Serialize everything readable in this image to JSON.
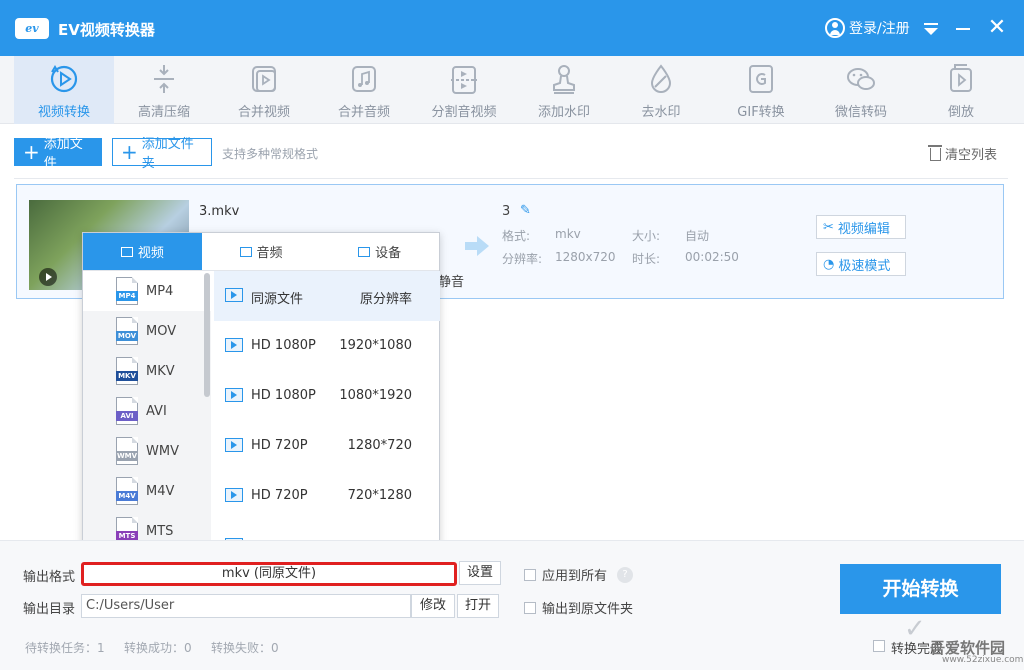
{
  "app": {
    "title": "EV视频转换器",
    "logo_text": "ev",
    "login": "登录/注册"
  },
  "toolbar": [
    {
      "label": "视频转换",
      "icon": "video-convert-icon"
    },
    {
      "label": "高清压缩",
      "icon": "compress-icon"
    },
    {
      "label": "合并视频",
      "icon": "merge-video-icon"
    },
    {
      "label": "合并音频",
      "icon": "merge-audio-icon"
    },
    {
      "label": "分割音视频",
      "icon": "split-icon"
    },
    {
      "label": "添加水印",
      "icon": "add-watermark-icon"
    },
    {
      "label": "去水印",
      "icon": "remove-watermark-icon"
    },
    {
      "label": "GIF转换",
      "icon": "gif-icon"
    },
    {
      "label": "微信转码",
      "icon": "wechat-icon"
    },
    {
      "label": "倒放",
      "icon": "reverse-icon"
    }
  ],
  "actions": {
    "add_file": "添加文件",
    "add_folder": "添加文件夹",
    "hint": "支持多种常规格式",
    "clear": "清空列表"
  },
  "file": {
    "name": "3.mkv",
    "mute": "静音",
    "output_name": "3",
    "format_label": "格式:",
    "format_value": "mkv",
    "size_label": "大小:",
    "size_value": "自动",
    "resolution_label": "分辨率:",
    "resolution_value": "1280x720",
    "duration_label": "时长:",
    "duration_value": "00:02:50",
    "edit_button": "视频编辑",
    "fast_button": "极速模式"
  },
  "popup": {
    "tabs": [
      "视频",
      "音频",
      "设备"
    ],
    "formats": [
      {
        "name": "MP4",
        "color": "#2a96ea"
      },
      {
        "name": "MOV",
        "color": "#3d8fd8"
      },
      {
        "name": "MKV",
        "color": "#1f4f9a"
      },
      {
        "name": "AVI",
        "color": "#6c5fc7"
      },
      {
        "name": "WMV",
        "color": "#9aa3b0"
      },
      {
        "name": "M4V",
        "color": "#4a7bd6"
      },
      {
        "name": "MTS",
        "color": "#8a3fb8"
      }
    ],
    "presets": [
      {
        "name": "同源文件",
        "res": "原分辨率"
      },
      {
        "name": "HD 1080P",
        "res": "1920*1080"
      },
      {
        "name": "HD 1080P",
        "res": "1080*1920"
      },
      {
        "name": "HD 720P",
        "res": "1280*720"
      },
      {
        "name": "HD 720P",
        "res": "720*1280"
      },
      {
        "name": "",
        "res": ""
      }
    ]
  },
  "bottom": {
    "format_label": "输出格式",
    "format_value": "mkv (同原文件)",
    "settings": "设置",
    "apply_all": "应用到所有",
    "help": "?",
    "dir_label": "输出目录",
    "dir_value": "C:/Users/User",
    "modify": "修改",
    "open": "打开",
    "to_source": "输出到原文件夹",
    "start": "开始转换",
    "pending": "待转换任务：1",
    "success": "转换成功：0",
    "failed": "转换失败：0",
    "after_convert": "转换完成"
  },
  "watermark": {
    "cn": "吾爱软件园",
    "url": "www.52zixue.com"
  }
}
